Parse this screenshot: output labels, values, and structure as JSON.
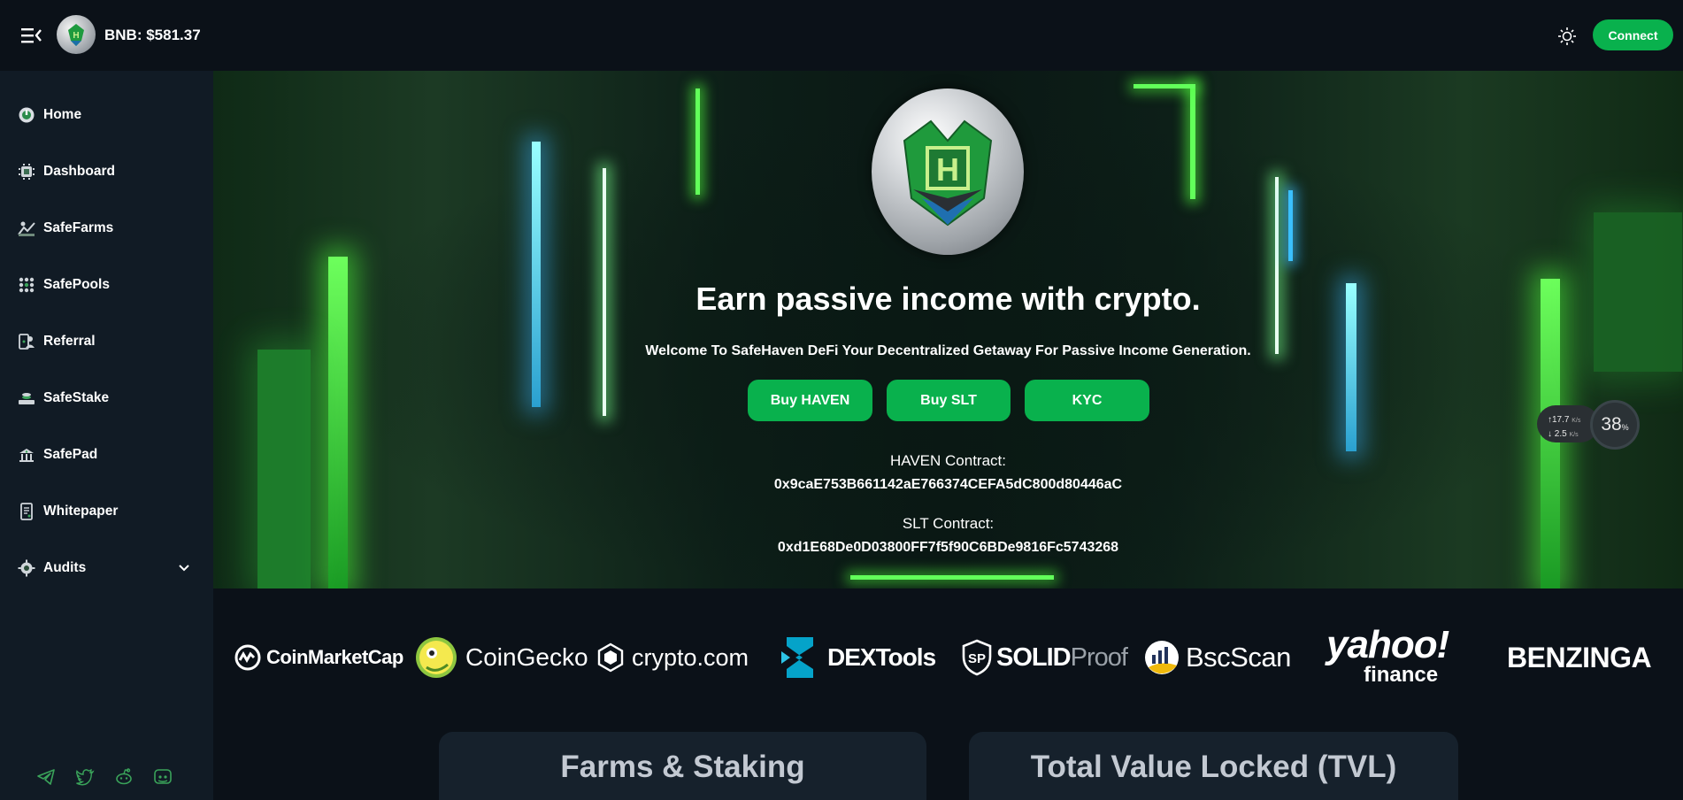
{
  "header": {
    "bnb_price": "BNB: $581.37",
    "connect_label": "Connect"
  },
  "sidebar": {
    "items": [
      {
        "label": "Home",
        "icon": "home-icon"
      },
      {
        "label": "Dashboard",
        "icon": "dashboard-icon"
      },
      {
        "label": "SafeFarms",
        "icon": "farm-icon"
      },
      {
        "label": "SafePools",
        "icon": "pools-icon"
      },
      {
        "label": "Referral",
        "icon": "referral-icon"
      },
      {
        "label": "SafeStake",
        "icon": "stake-icon"
      },
      {
        "label": "SafePad",
        "icon": "launchpad-icon"
      },
      {
        "label": "Whitepaper",
        "icon": "document-icon"
      },
      {
        "label": "Audits",
        "icon": "audit-icon"
      }
    ],
    "socials": [
      "telegram-icon",
      "twitter-icon",
      "reddit-icon",
      "discord-icon"
    ]
  },
  "hero": {
    "title": "Earn passive income with crypto.",
    "subtitle": "Welcome To SafeHaven DeFi Your Decentralized Getaway For Passive Income Generation.",
    "buttons": [
      "Buy HAVEN",
      "Buy SLT",
      "KYC"
    ],
    "haven_label": "HAVEN Contract:",
    "haven_address": "0x9caE753B661142aE766374CEFA5dC800d80446aC",
    "slt_label": "SLT Contract:",
    "slt_address": "0xd1E68De0D03800FF7f5f90C6BDe9816Fc5743268"
  },
  "net_widget": {
    "upload": "17.7",
    "download": "2.5",
    "unit": "K/s",
    "percent": "38",
    "percent_sign": "%"
  },
  "partners": {
    "coinmarketcap": "CoinMarketCap",
    "coingecko": "CoinGecko",
    "cryptocom": "crypto.com",
    "dextools": "DEXTools",
    "solid": "SOLID",
    "proof": "Proof",
    "bscscan": "BscScan",
    "yahoo": "yahoo!",
    "finance": "finance",
    "benzinga": "BENZINGA"
  },
  "cards": {
    "farms_title": "Farms & Staking",
    "tvl_title": "Total Value Locked (TVL)"
  },
  "colors": {
    "accent": "#09b14d",
    "sidebar": "#111b25",
    "background": "#0b1118"
  }
}
